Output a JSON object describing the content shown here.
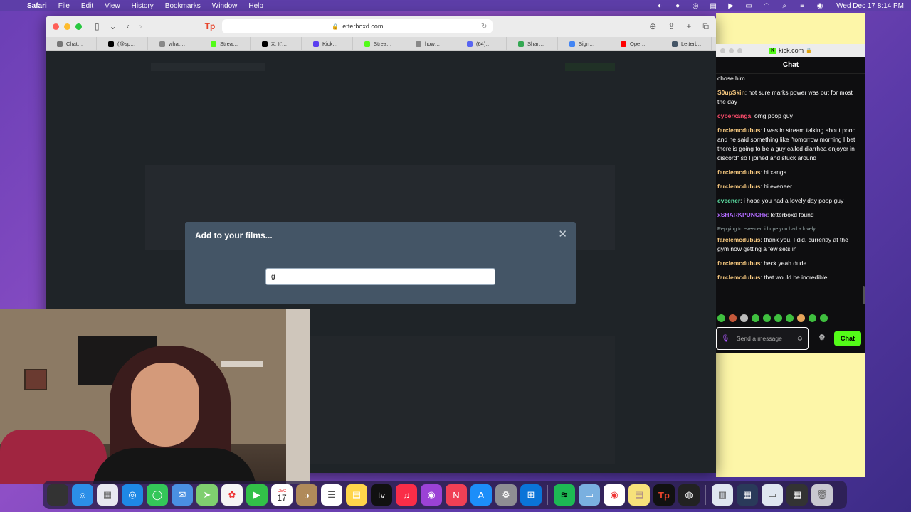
{
  "menubar": {
    "app_name": "Safari",
    "menus": [
      "File",
      "Edit",
      "View",
      "History",
      "Bookmarks",
      "Window",
      "Help"
    ],
    "clock": "Wed Dec 17  8:14 PM"
  },
  "safari": {
    "address": "letterboxd.com",
    "tabs": [
      {
        "label": "Chat…",
        "icon": "chatgpt-icon",
        "color": "#777777"
      },
      {
        "label": "(@sp…",
        "icon": "tiktok-icon",
        "color": "#000000"
      },
      {
        "label": "what…",
        "icon": "generic-icon",
        "color": "#888888"
      },
      {
        "label": "Strea…",
        "icon": "kick-icon",
        "color": "#53fc18"
      },
      {
        "label": "X. It'…",
        "icon": "x-icon",
        "color": "#000000"
      },
      {
        "label": "Kick…",
        "icon": "kick-purple-icon",
        "color": "#5b3ff0"
      },
      {
        "label": "Strea…",
        "icon": "kick-icon",
        "color": "#53fc18"
      },
      {
        "label": "how…",
        "icon": "generic-icon",
        "color": "#888888"
      },
      {
        "label": "(64)…",
        "icon": "discord-icon",
        "color": "#5865f2"
      },
      {
        "label": "Shar…",
        "icon": "drive-icon",
        "color": "#34a853"
      },
      {
        "label": "Sign…",
        "icon": "google-icon",
        "color": "#4285f4"
      },
      {
        "label": "Ope…",
        "icon": "youtube-icon",
        "color": "#ff0000"
      },
      {
        "label": "Letterb…",
        "icon": "letterboxd-icon",
        "color": "#445566"
      }
    ],
    "modal": {
      "title": "Add to your films...",
      "input_value": "g"
    }
  },
  "kick": {
    "url": "kick.com",
    "header": "Chat",
    "messages": [
      {
        "user": "",
        "text": "chose him",
        "color": "#ffffff"
      },
      {
        "user": "S0upSkin",
        "text": "not sure marks power was out for most the day",
        "color": "#f5c77e"
      },
      {
        "user": "cyberxanga",
        "text": "omg poop guy",
        "color": "#ff4d6d"
      },
      {
        "user": "farclemcdubus",
        "text": "I was in stream talking about poop and he said something like \"tomorrow morning I bet there is going to be a guy called diarrhea enjoyer in discord\" so I joined and stuck around",
        "color": "#f5c77e"
      },
      {
        "user": "farclemcdubus",
        "text": "hi xanga",
        "color": "#f5c77e"
      },
      {
        "user": "farclemcdubus",
        "text": "hi eveneer",
        "color": "#f5c77e"
      },
      {
        "user": "eveener",
        "text": "i hope you had a lovely day poop guy",
        "color": "#5ee6a8"
      },
      {
        "user": "xSHARKPUNCHx",
        "text": "letterboxd found",
        "color": "#b26cff"
      },
      {
        "user": "farclemcdubus",
        "text": "thank you, I did, currently at the gym now getting a few sets in",
        "color": "#f5c77e",
        "reply": "Replying to eveener: i hope you had a lovely ..."
      },
      {
        "user": "farclemcdubus",
        "text": "heck yeah dude",
        "color": "#f5c77e"
      },
      {
        "user": "farclemcdubus",
        "text": "that would be incredible",
        "color": "#f5c77e"
      }
    ],
    "input_placeholder": "Send a message",
    "send_label": "Chat"
  },
  "dock": {
    "calendar_month": "DEC",
    "calendar_day": "17",
    "apps": [
      "finder-icon",
      "launchpad-icon",
      "safari-icon",
      "messages-icon",
      "mail-icon",
      "maps-icon",
      "photos-icon",
      "facetime-icon",
      "calendar-icon",
      "contacts-icon",
      "reminders-icon",
      "notes-icon",
      "tv-icon",
      "music-icon",
      "podcasts-icon",
      "news-icon",
      "app-store-icon",
      "system-settings-icon",
      "windows-app-icon",
      "spotify-icon",
      "preview-icon",
      "chrome-icon",
      "stickies-icon",
      "teleprompter-icon",
      "obs-icon"
    ]
  }
}
